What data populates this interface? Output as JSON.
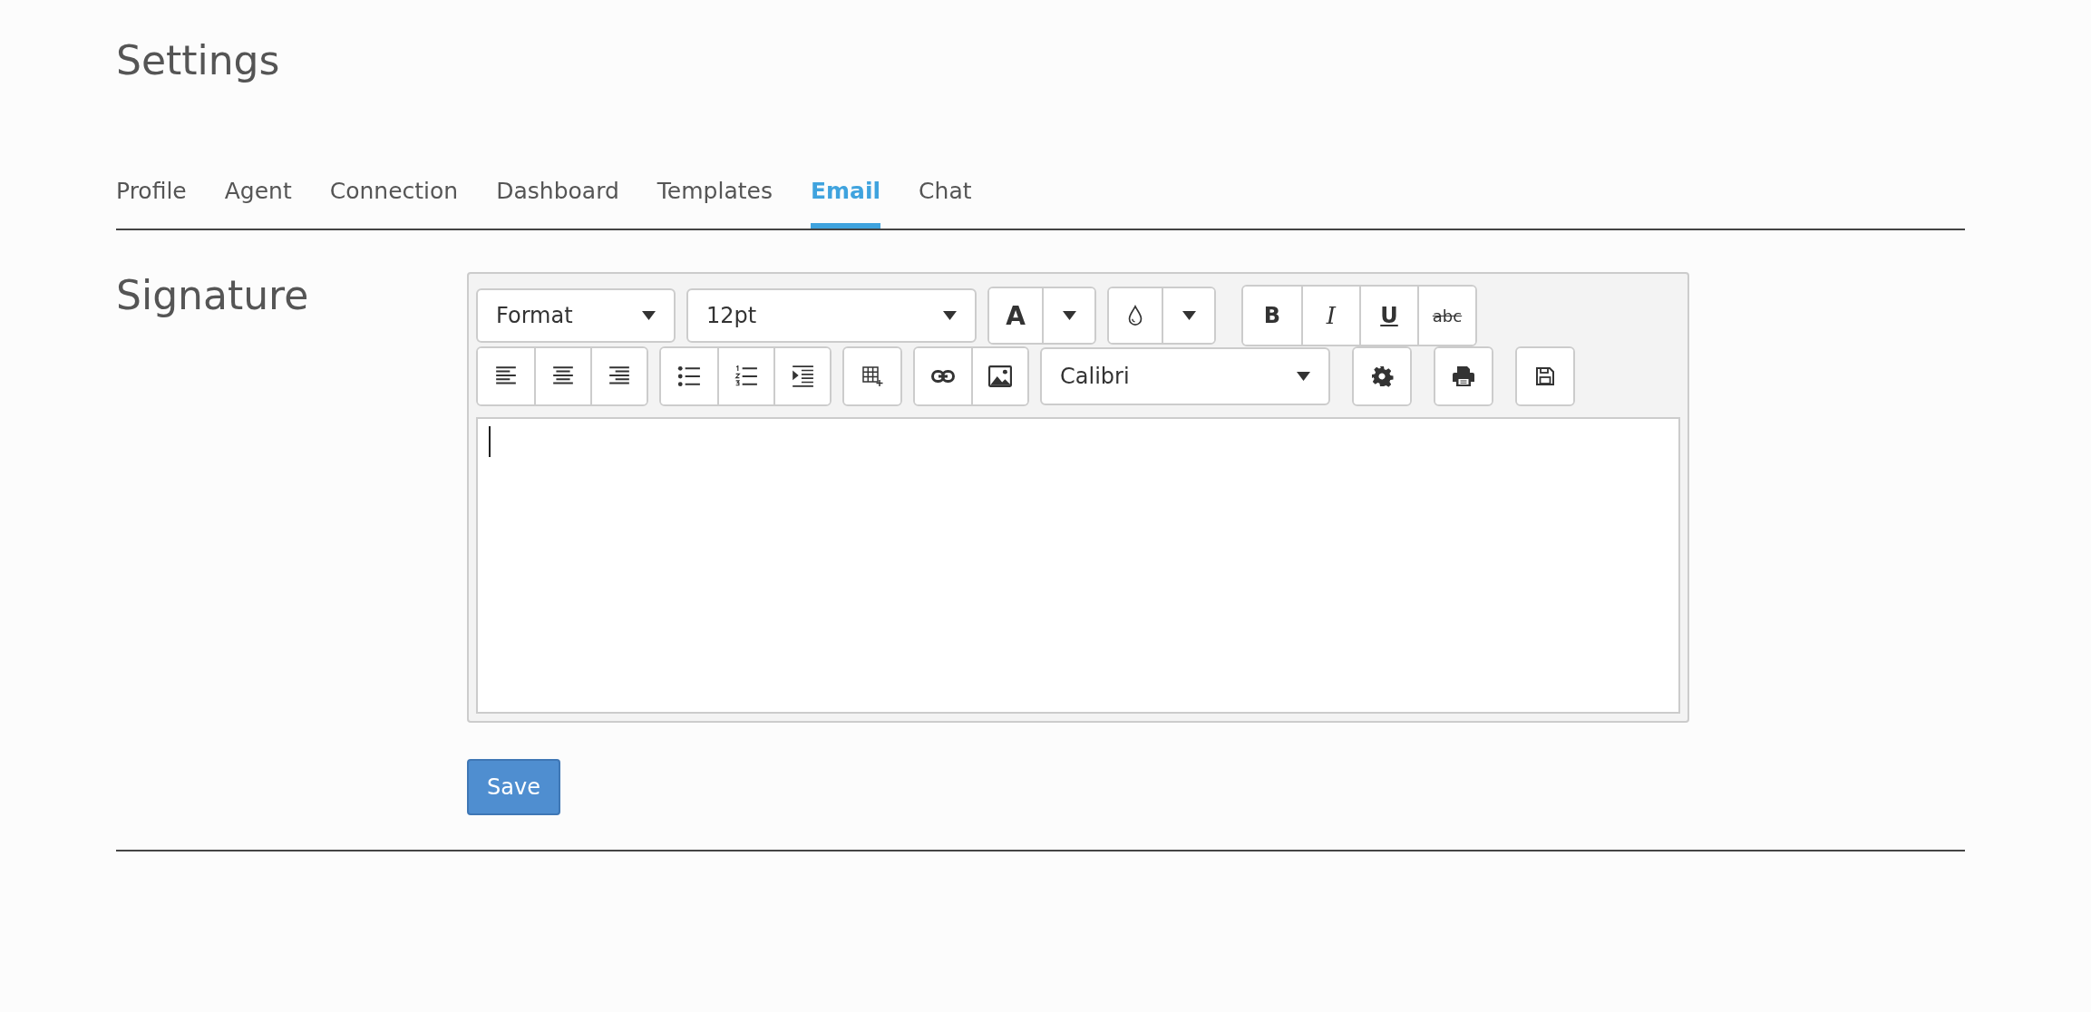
{
  "page": {
    "title": "Settings"
  },
  "tabs": [
    {
      "label": "Profile",
      "selected": false
    },
    {
      "label": "Agent",
      "selected": false
    },
    {
      "label": "Connection",
      "selected": false
    },
    {
      "label": "Dashboard",
      "selected": false
    },
    {
      "label": "Templates",
      "selected": false
    },
    {
      "label": "Email",
      "selected": true
    },
    {
      "label": "Chat",
      "selected": false
    }
  ],
  "section": {
    "label": "Signature"
  },
  "editor": {
    "format": "Format",
    "font_size": "12pt",
    "text_color": "A",
    "bold": "B",
    "italic": "I",
    "underline": "U",
    "strikethrough": "abc",
    "font": "Calibri"
  },
  "save_button": "Save"
}
